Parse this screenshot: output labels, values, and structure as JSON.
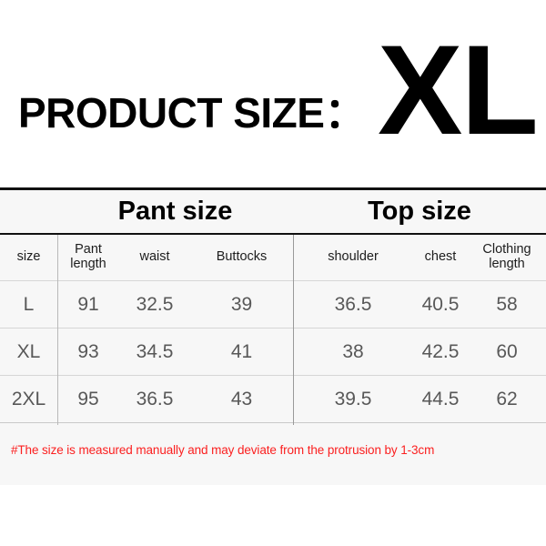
{
  "header": {
    "title": "PRODUCT SIZE：",
    "selected_size": "XL"
  },
  "table": {
    "sections": [
      {
        "label": "Pant size"
      },
      {
        "label": "Top size"
      }
    ],
    "columns": [
      "size",
      "Pant length",
      "waist",
      "Buttocks",
      "shoulder",
      "chest",
      "Clothing length"
    ],
    "rows": [
      {
        "size": "L",
        "pant_length": "91",
        "waist": "32.5",
        "buttocks": "39",
        "shoulder": "36.5",
        "chest": "40.5",
        "clothing_length": "58"
      },
      {
        "size": "XL",
        "pant_length": "93",
        "waist": "34.5",
        "buttocks": "41",
        "shoulder": "38",
        "chest": "42.5",
        "clothing_length": "60"
      },
      {
        "size": "2XL",
        "pant_length": "95",
        "waist": "36.5",
        "buttocks": "43",
        "shoulder": "39.5",
        "chest": "44.5",
        "clothing_length": "62"
      }
    ]
  },
  "footnote": {
    "text": "#The size is measured manually and may deviate from the protrusion by 1-3cm",
    "color": "#fb2020"
  }
}
